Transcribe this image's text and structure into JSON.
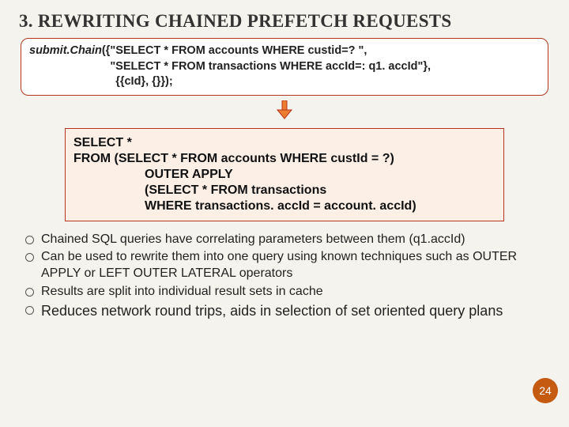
{
  "title": "3. Rᴇᴡʀɪᴛɪɴɢ Cʜᴀɪɴᴇᴅ ᴘʀᴇꜰᴇᴛᴄʜ ʀᴇQᴜᴇsᴛs",
  "title_plain": "3. REWRITING CHAINED PREFETCH REQUESTS",
  "code1": {
    "fn": "submit.Chain",
    "line1a": "({\"SELECT * FROM accounts WHERE custid=? \",",
    "line2": "\"SELECT * FROM transactions WHERE accId=: q1. accId\"},",
    "line3": "{{cId}, {}});"
  },
  "code2": {
    "l1": "SELECT *",
    "l2": "FROM (SELECT * FROM accounts WHERE custId = ?)",
    "l3": "OUTER APPLY",
    "l4": "(SELECT * FROM transactions",
    "l5": " WHERE transactions. accId = account. accId)"
  },
  "bullets": [
    "Chained SQL queries have correlating parameters between them (q1.accId)",
    "Can be used to rewrite them into one query using known techniques such as OUTER APPLY or LEFT OUTER LATERAL operators",
    "Results are split into individual result sets in cache",
    "Reduces network round trips, aids in selection of set oriented query plans"
  ],
  "slide_number": "24"
}
